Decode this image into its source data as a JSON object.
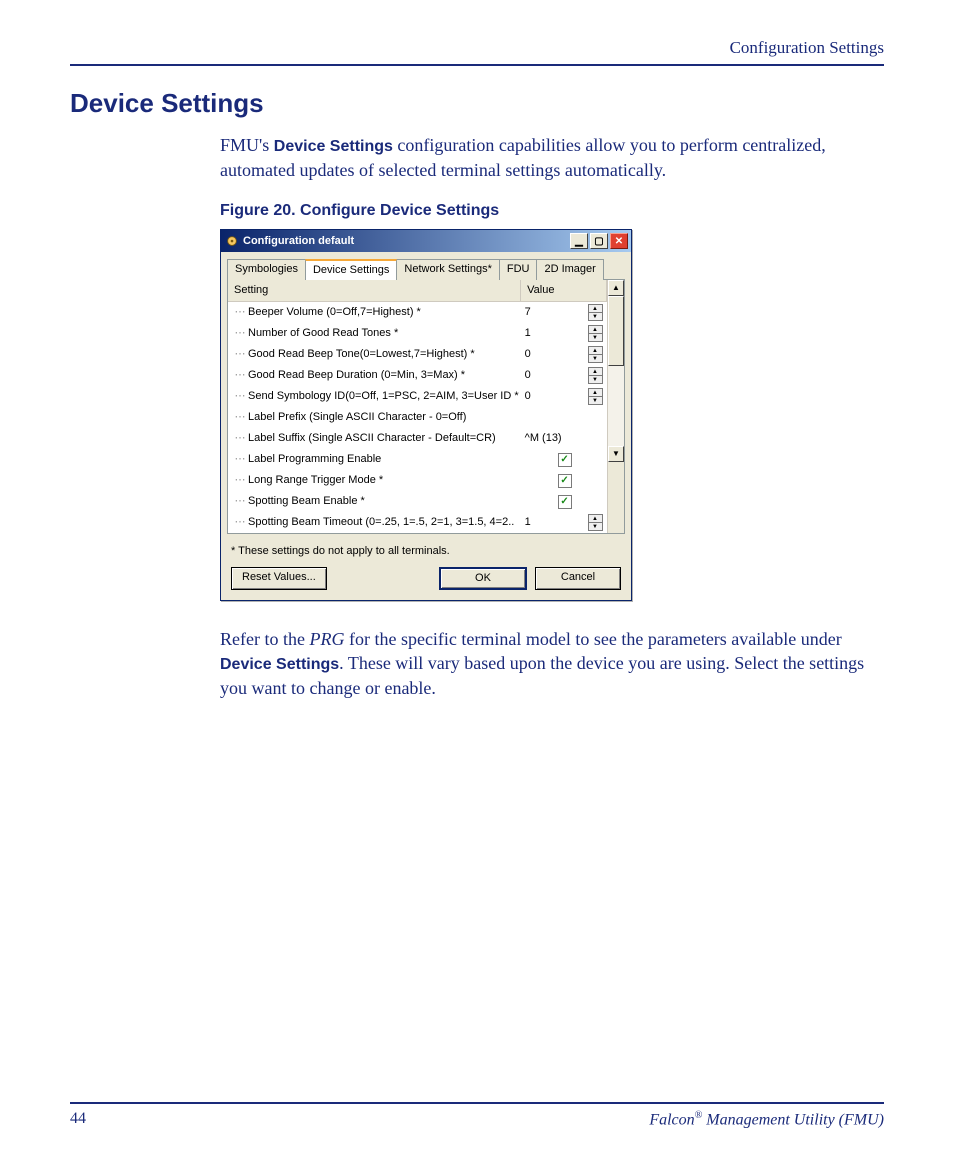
{
  "header": {
    "section": "Configuration Settings"
  },
  "title": "Device Settings",
  "intro": {
    "pre": "FMU's ",
    "bold": "Device Settings",
    "post": " configuration capabilities allow you to perform centralized, automated updates of selected terminal settings automatically."
  },
  "figure_caption": "Figure 20. Configure Device Settings",
  "dialog": {
    "title": "Configuration default",
    "tabs": [
      "Symbologies",
      "Device Settings",
      "Network Settings*",
      "FDU",
      "2D Imager"
    ],
    "active_tab": 1,
    "columns": {
      "setting": "Setting",
      "value": "Value"
    },
    "rows": [
      {
        "name": "Beeper Volume (0=Off,7=Highest) *",
        "value": "7",
        "control": "spin"
      },
      {
        "name": "Number of Good Read Tones *",
        "value": "1",
        "control": "spin"
      },
      {
        "name": "Good Read Beep Tone(0=Lowest,7=Highest) *",
        "value": "0",
        "control": "spin"
      },
      {
        "name": "Good Read Beep Duration (0=Min, 3=Max) *",
        "value": "0",
        "control": "spin"
      },
      {
        "name": "Send Symbology ID(0=Off, 1=PSC, 2=AIM, 3=User ID *",
        "value": "0",
        "control": "spin"
      },
      {
        "name": "Label Prefix (Single ASCII Character - 0=Off)",
        "value": "",
        "control": "none"
      },
      {
        "name": "Label Suffix (Single ASCII Character - Default=CR)",
        "value": "^M (13)",
        "control": "none"
      },
      {
        "name": "Label Programming Enable",
        "value": "",
        "control": "check",
        "checked": true
      },
      {
        "name": "Long Range Trigger Mode *",
        "value": "",
        "control": "check",
        "checked": true
      },
      {
        "name": "Spotting Beam Enable *",
        "value": "",
        "control": "check",
        "checked": true
      },
      {
        "name": "Spotting Beam Timeout (0=.25, 1=.5, 2=1, 3=1.5, 4=2..",
        "value": "1",
        "control": "spin"
      }
    ],
    "note": "* These settings do not apply to all terminals.",
    "buttons": {
      "reset": "Reset Values...",
      "ok": "OK",
      "cancel": "Cancel"
    }
  },
  "para2": {
    "t1": "Refer to the ",
    "italic": "PRG",
    "t2": " for the specific terminal model to see the parameters available under ",
    "bold": "Device Settings",
    "t3": ". These will vary based upon the device you are using. Select the settings you want to change or enable."
  },
  "footer": {
    "page": "44",
    "product_pre": "Falcon",
    "product_reg": "®",
    "product_post": " Management Utility (FMU)"
  }
}
